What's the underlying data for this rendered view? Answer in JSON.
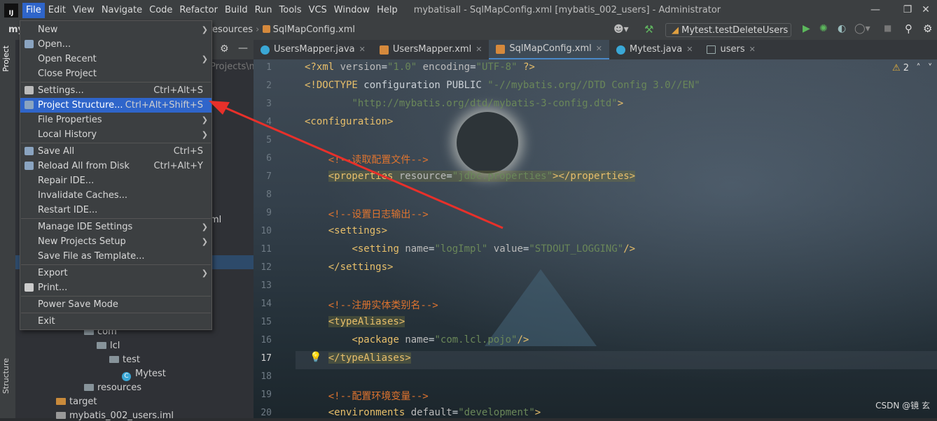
{
  "app": {
    "logo_text": "IJ",
    "window_title": "mybatisall - SqlMapConfig.xml [mybatis_002_users] - Administrator",
    "menu": [
      "File",
      "Edit",
      "View",
      "Navigate",
      "Code",
      "Refactor",
      "Build",
      "Run",
      "Tools",
      "VCS",
      "Window",
      "Help"
    ]
  },
  "navbar": {
    "crumbs": [
      "resources",
      "SqlMapConfig.xml"
    ],
    "project_short": "my",
    "run_config": "Mytest.testDeleteUsers"
  },
  "side_tabs": {
    "project": "Project",
    "structure": "Structure"
  },
  "project_tree": {
    "path_hint": "Projects\\m",
    "iml_hint": "ml",
    "items": [
      {
        "label": "com",
        "indent": 0,
        "kind": "folder"
      },
      {
        "label": "lcl",
        "indent": 1,
        "kind": "folder"
      },
      {
        "label": "test",
        "indent": 2,
        "kind": "folder"
      },
      {
        "label": "Mytest",
        "indent": 3,
        "kind": "java"
      },
      {
        "label": "resources",
        "indent": 0,
        "kind": "folder-res"
      },
      {
        "label": "target",
        "indent": -1,
        "kind": "folder-orange"
      },
      {
        "label": "mybatis_002_users.iml",
        "indent": -1,
        "kind": "file"
      }
    ]
  },
  "tabs": [
    {
      "label": "UsersMapper.java",
      "icon": "interface-icon",
      "active": false
    },
    {
      "label": "UsersMapper.xml",
      "icon": "xml-icon",
      "active": false
    },
    {
      "label": "SqlMapConfig.xml",
      "icon": "xml-icon",
      "active": true
    },
    {
      "label": "Mytest.java",
      "icon": "class-icon",
      "active": false
    },
    {
      "label": "users",
      "icon": "table-icon",
      "active": false
    }
  ],
  "inspection": {
    "warnings": "2"
  },
  "file_menu": {
    "items": [
      {
        "label": "New",
        "shortcut": "",
        "submenu": true
      },
      {
        "label": "Open...",
        "shortcut": "",
        "submenu": false
      },
      {
        "label": "Open Recent",
        "shortcut": "",
        "submenu": true
      },
      {
        "label": "Close Project",
        "shortcut": "",
        "submenu": false
      },
      {
        "label": "Settings...",
        "shortcut": "Ctrl+Alt+S",
        "submenu": false
      },
      {
        "label": "Project Structure...",
        "shortcut": "Ctrl+Alt+Shift+S",
        "submenu": false,
        "selected": true
      },
      {
        "label": "File Properties",
        "shortcut": "",
        "submenu": true
      },
      {
        "label": "Local History",
        "shortcut": "",
        "submenu": true
      },
      {
        "label": "Save All",
        "shortcut": "Ctrl+S",
        "submenu": false
      },
      {
        "label": "Reload All from Disk",
        "shortcut": "Ctrl+Alt+Y",
        "submenu": false
      },
      {
        "label": "Repair IDE...",
        "shortcut": "",
        "submenu": false
      },
      {
        "label": "Invalidate Caches...",
        "shortcut": "",
        "submenu": false
      },
      {
        "label": "Restart IDE...",
        "shortcut": "",
        "submenu": false
      },
      {
        "label": "Manage IDE Settings",
        "shortcut": "",
        "submenu": true
      },
      {
        "label": "New Projects Setup",
        "shortcut": "",
        "submenu": true
      },
      {
        "label": "Save File as Template...",
        "shortcut": "",
        "submenu": false
      },
      {
        "label": "Export",
        "shortcut": "",
        "submenu": true
      },
      {
        "label": "Print...",
        "shortcut": "",
        "submenu": false
      },
      {
        "label": "Power Save Mode",
        "shortcut": "",
        "submenu": false
      },
      {
        "label": "Exit",
        "shortcut": "",
        "submenu": false
      }
    ]
  },
  "code_lines": [
    {
      "n": "1",
      "html": "<span class='t'>&lt;?xml</span> <span class='a'>version</span>=<span class='v'>\"1.0\"</span> <span class='a'>encoding</span>=<span class='v'>\"UTF-8\"</span> <span class='t'>?&gt;</span>"
    },
    {
      "n": "2",
      "html": "<span class='t'>&lt;!DOCTYPE</span> configuration PUBLIC <span class='v'>\"-//mybatis.org//DTD Config 3.0//EN\"</span>"
    },
    {
      "n": "3",
      "html": "        <span class='v'>\"http://mybatis.org/dtd/mybatis-3-config.dtd\"</span><span class='t'>&gt;</span>"
    },
    {
      "n": "4",
      "html": "<span class='t'>&lt;configuration&gt;</span>"
    },
    {
      "n": "5",
      "html": ""
    },
    {
      "n": "6",
      "html": "    <span class='c'>&lt;!--读取配置文件--&gt;</span>"
    },
    {
      "n": "7",
      "html": "    <span class='hl'><span class='t'>&lt;properties</span> <span class='a'>resource</span>=<span class='v'>\"jdbc.properties\"</span><span class='t'>&gt;&lt;/properties&gt;</span></span>"
    },
    {
      "n": "8",
      "html": ""
    },
    {
      "n": "9",
      "html": "    <span class='c'>&lt;!--设置日志输出--&gt;</span>"
    },
    {
      "n": "10",
      "html": "    <span class='t'>&lt;settings&gt;</span>"
    },
    {
      "n": "11",
      "html": "        <span class='t'>&lt;setting</span> <span class='a'>name</span>=<span class='v'>\"logImpl\"</span> <span class='a'>value</span>=<span class='v'>\"STDOUT_LOGGING\"</span><span class='t'>/&gt;</span>"
    },
    {
      "n": "12",
      "html": "    <span class='t'>&lt;/settings&gt;</span>"
    },
    {
      "n": "13",
      "html": ""
    },
    {
      "n": "14",
      "html": "    <span class='c'>&lt;!--注册实体类别名--&gt;</span>"
    },
    {
      "n": "15",
      "html": "    <span class='hl'><span class='t'>&lt;typeAliases&gt;</span></span>"
    },
    {
      "n": "16",
      "html": "        <span class='t'>&lt;package</span> <span class='a'>name</span>=<span class='v'>\"com.lcl.pojo\"</span><span class='t'>/&gt;</span>"
    },
    {
      "n": "17",
      "html": "    <span class='hl'><span class='t'>&lt;/typeAliases&gt;</span></span>"
    },
    {
      "n": "18",
      "html": ""
    },
    {
      "n": "19",
      "html": "    <span class='c'>&lt;!--配置环境变量--&gt;</span>"
    },
    {
      "n": "20",
      "html": "    <span class='t'>&lt;environments</span> <span class='a'>default</span>=<span class='v'>\"development\"</span><span class='t'>&gt;</span>"
    }
  ],
  "watermark": "CSDN @镜 玄"
}
